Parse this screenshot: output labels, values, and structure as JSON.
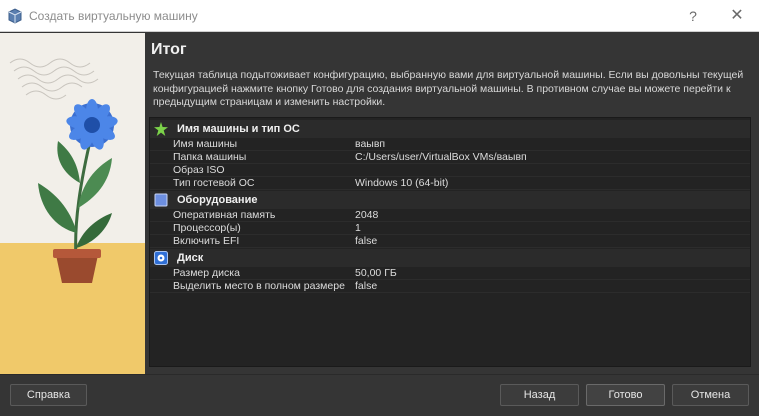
{
  "window": {
    "title": "Создать виртуальную машину",
    "help_glyph": "?",
    "close_glyph": "✕"
  },
  "page": {
    "title": "Итог",
    "description": "Текущая таблица подытоживает конфигурацию, выбранную вами для виртуальной машины. Если вы довольны текущей конфигурацией нажмите кнопку Готово для создания виртуальной машины. В противном случае вы можете перейти к предыдущим страницам и изменить настройки."
  },
  "summary": {
    "sections": [
      {
        "title": "Имя машины и тип ОС",
        "icon": "star-icon",
        "rows": [
          {
            "key": "Имя машины",
            "value": "ваывп"
          },
          {
            "key": "Папка машины",
            "value": "C:/Users/user/VirtualBox VMs/ваывп"
          },
          {
            "key": "Образ ISO",
            "value": ""
          },
          {
            "key": "Тип гостевой ОС",
            "value": "Windows 10 (64-bit)"
          }
        ]
      },
      {
        "title": "Оборудование",
        "icon": "chip-icon",
        "rows": [
          {
            "key": "Оперативная память",
            "value": "2048"
          },
          {
            "key": "Процессор(ы)",
            "value": "1"
          },
          {
            "key": "Включить EFI",
            "value": "false"
          }
        ]
      },
      {
        "title": "Диск",
        "icon": "disk-icon",
        "rows": [
          {
            "key": "Размер диска",
            "value": "50,00 ГБ"
          },
          {
            "key": "Выделить место в полном размере",
            "value": "false"
          }
        ]
      }
    ]
  },
  "footer": {
    "help": "Справка",
    "back": "Назад",
    "done": "Готово",
    "cancel": "Отмена"
  },
  "colors": {
    "background": "#353535",
    "table": "#232323",
    "accent_green": "#7cd34a",
    "accent_blue": "#2f6fd6"
  }
}
